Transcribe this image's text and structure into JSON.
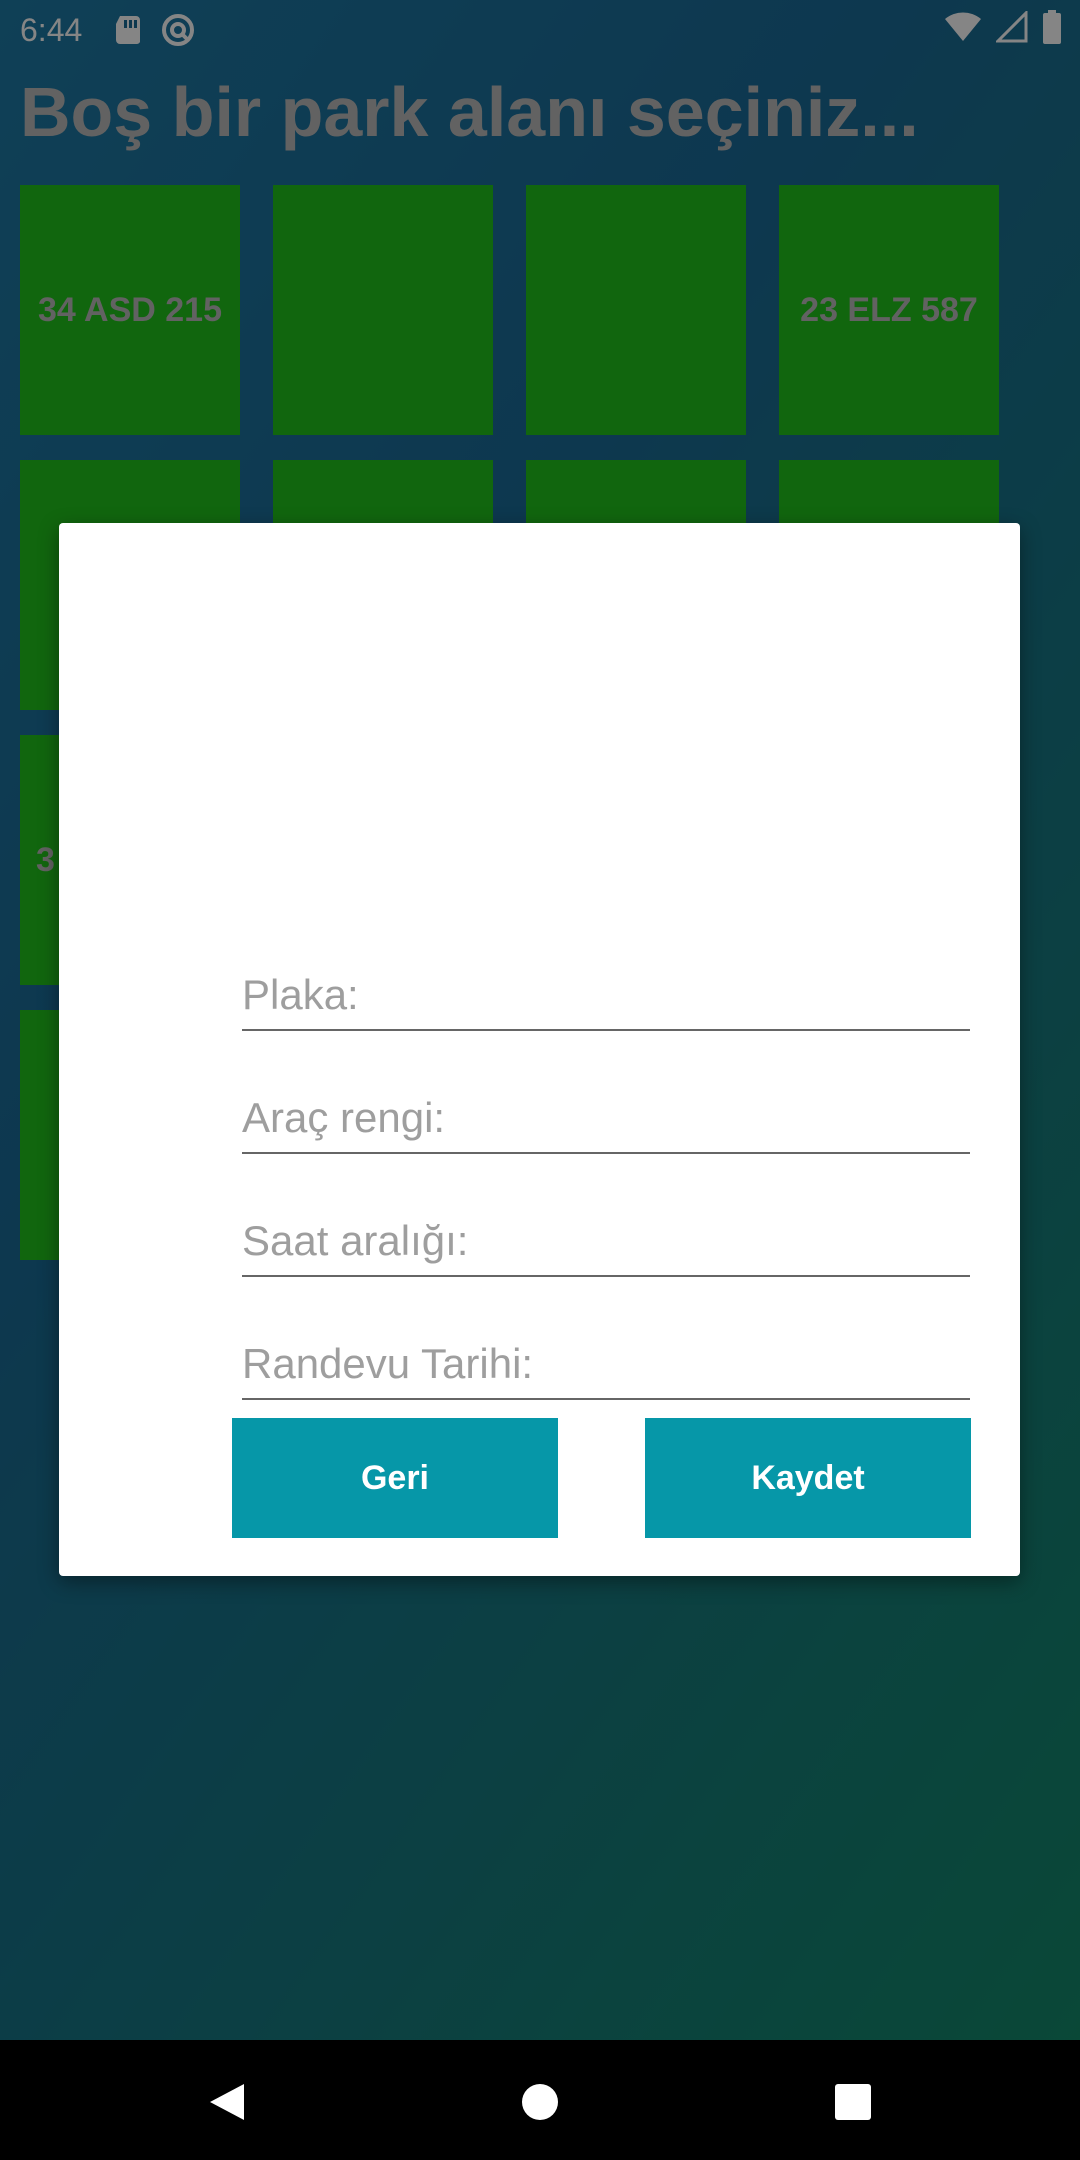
{
  "status_bar": {
    "time": "6:44",
    "left_icons": [
      "sd-card-icon",
      "sync-icon"
    ],
    "right_icons": [
      "wifi-icon",
      "signal-icon",
      "battery-icon"
    ]
  },
  "page": {
    "title": "Boş bir park alanı seçiniz...",
    "slots": [
      {
        "label": "34 ASD 215"
      },
      {
        "label": ""
      },
      {
        "label": ""
      },
      {
        "label": "23 ELZ 587"
      },
      {
        "label": ""
      },
      {
        "label": ""
      },
      {
        "label": ""
      },
      {
        "label": ""
      },
      {
        "label": "3"
      },
      {
        "label": ""
      }
    ],
    "colors": {
      "slot_green": "#22c31c",
      "button_teal": "#0697a8",
      "title_gray": "#bdbdbd"
    }
  },
  "dialog": {
    "plate_placeholder": "Plaka:",
    "color_placeholder": "Araç rengi:",
    "hours_placeholder": "Saat aralığı:",
    "date_placeholder": "Randevu Tarihi:",
    "back_label": "Geri",
    "save_label": "Kaydet"
  },
  "nav_bar": {
    "buttons": [
      "back-icon",
      "home-icon",
      "recents-icon"
    ]
  }
}
